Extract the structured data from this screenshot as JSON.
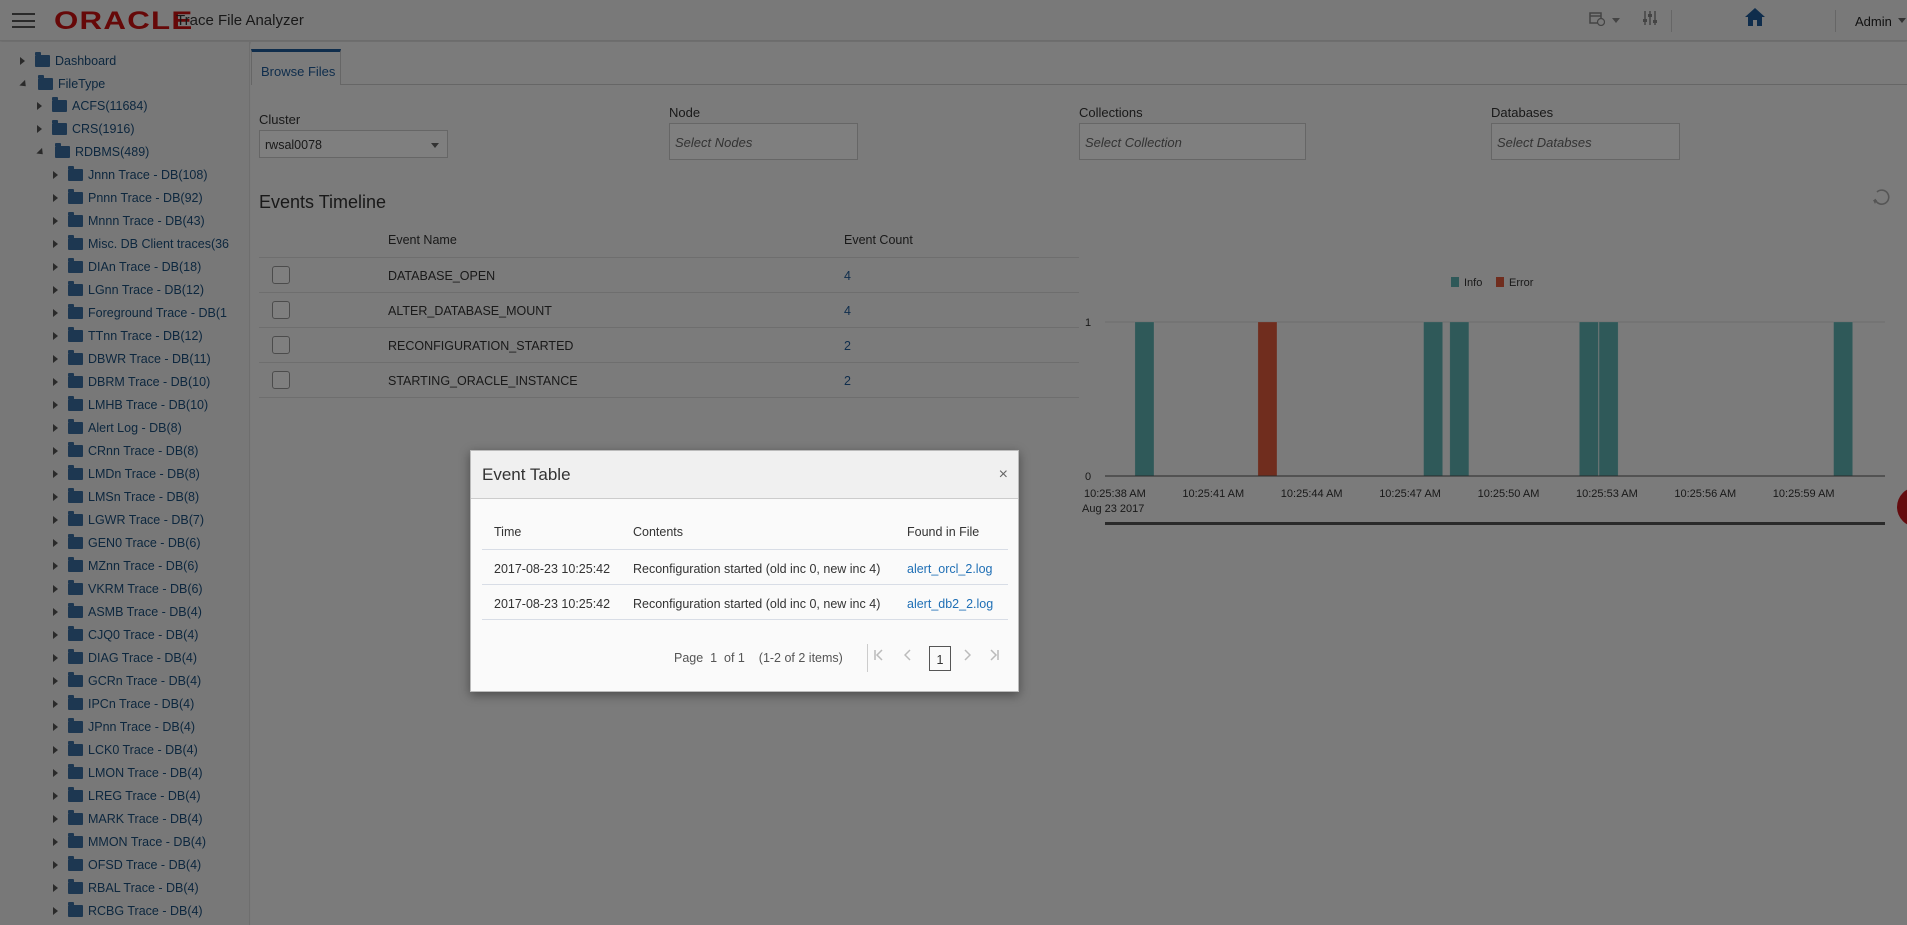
{
  "header": {
    "logo": "ORACLE",
    "app_title": "Trace File Analyzer",
    "user": "Admin",
    "icons": [
      "menu-icon",
      "calendar-clock-icon",
      "sliders-icon",
      "home-icon"
    ]
  },
  "sidebar": {
    "items": [
      {
        "label": "Dashboard",
        "level": 0,
        "expanded": false
      },
      {
        "label": "FileType",
        "level": 0,
        "expanded": true
      },
      {
        "label": "ACFS(11684)",
        "level": 1,
        "expanded": false
      },
      {
        "label": "CRS(1916)",
        "level": 1,
        "expanded": false
      },
      {
        "label": "RDBMS(489)",
        "level": 1,
        "expanded": true
      },
      {
        "label": "Jnnn Trace - DB(108)",
        "level": 2,
        "expanded": false
      },
      {
        "label": "Pnnn Trace - DB(92)",
        "level": 2,
        "expanded": false
      },
      {
        "label": "Mnnn Trace - DB(43)",
        "level": 2,
        "expanded": false
      },
      {
        "label": "Misc. DB Client traces(36",
        "level": 2,
        "expanded": false
      },
      {
        "label": "DIAn Trace - DB(18)",
        "level": 2,
        "expanded": false
      },
      {
        "label": "LGnn Trace - DB(12)",
        "level": 2,
        "expanded": false
      },
      {
        "label": "Foreground Trace - DB(1",
        "level": 2,
        "expanded": false
      },
      {
        "label": "TTnn Trace - DB(12)",
        "level": 2,
        "expanded": false
      },
      {
        "label": "DBWR Trace - DB(11)",
        "level": 2,
        "expanded": false
      },
      {
        "label": "DBRM Trace - DB(10)",
        "level": 2,
        "expanded": false
      },
      {
        "label": "LMHB Trace - DB(10)",
        "level": 2,
        "expanded": false
      },
      {
        "label": "Alert Log - DB(8)",
        "level": 2,
        "expanded": false
      },
      {
        "label": "CRnn Trace - DB(8)",
        "level": 2,
        "expanded": false
      },
      {
        "label": "LMDn Trace - DB(8)",
        "level": 2,
        "expanded": false
      },
      {
        "label": "LMSn Trace - DB(8)",
        "level": 2,
        "expanded": false
      },
      {
        "label": "LGWR Trace - DB(7)",
        "level": 2,
        "expanded": false
      },
      {
        "label": "GEN0 Trace - DB(6)",
        "level": 2,
        "expanded": false
      },
      {
        "label": "MZnn Trace - DB(6)",
        "level": 2,
        "expanded": false
      },
      {
        "label": "VKRM Trace - DB(6)",
        "level": 2,
        "expanded": false
      },
      {
        "label": "ASMB Trace - DB(4)",
        "level": 2,
        "expanded": false
      },
      {
        "label": "CJQ0 Trace - DB(4)",
        "level": 2,
        "expanded": false
      },
      {
        "label": "DIAG Trace - DB(4)",
        "level": 2,
        "expanded": false
      },
      {
        "label": "GCRn Trace - DB(4)",
        "level": 2,
        "expanded": false
      },
      {
        "label": "IPCn Trace - DB(4)",
        "level": 2,
        "expanded": false
      },
      {
        "label": "JPnn Trace - DB(4)",
        "level": 2,
        "expanded": false
      },
      {
        "label": "LCK0 Trace - DB(4)",
        "level": 2,
        "expanded": false
      },
      {
        "label": "LMON Trace - DB(4)",
        "level": 2,
        "expanded": false
      },
      {
        "label": "LREG Trace - DB(4)",
        "level": 2,
        "expanded": false
      },
      {
        "label": "MARK Trace - DB(4)",
        "level": 2,
        "expanded": false
      },
      {
        "label": "MMON Trace - DB(4)",
        "level": 2,
        "expanded": false
      },
      {
        "label": "OFSD Trace - DB(4)",
        "level": 2,
        "expanded": false
      },
      {
        "label": "RBAL Trace - DB(4)",
        "level": 2,
        "expanded": false
      },
      {
        "label": "RCBG Trace - DB(4)",
        "level": 2,
        "expanded": false
      }
    ]
  },
  "main": {
    "tab": "Browse Files",
    "filters": {
      "cluster": {
        "label": "Cluster",
        "value": "rwsal0078"
      },
      "node": {
        "label": "Node",
        "placeholder": "Select Nodes"
      },
      "collections": {
        "label": "Collections",
        "placeholder": "Select Collection"
      },
      "databases": {
        "label": "Databases",
        "placeholder": "Select Databses"
      }
    },
    "section_title": "Events Timeline",
    "events_table": {
      "headers": {
        "name": "Event Name",
        "count": "Event Count"
      },
      "rows": [
        {
          "name": "DATABASE_OPEN",
          "count": "4",
          "checked": false
        },
        {
          "name": "ALTER_DATABASE_MOUNT",
          "count": "4",
          "checked": false
        },
        {
          "name": "RECONFIGURATION_STARTED",
          "count": "2",
          "checked": false
        },
        {
          "name": "STARTING_ORACLE_INSTANCE",
          "count": "2",
          "checked": false
        }
      ]
    }
  },
  "chart_data": {
    "type": "bar",
    "title": "",
    "xlabel": "",
    "ylabel": "",
    "ylim": [
      0,
      1
    ],
    "y_ticks": [
      "0",
      "1"
    ],
    "x_range_seconds": [
      38,
      62
    ],
    "x_ticks": [
      {
        "t": 38,
        "label": "10:25:38 AM",
        "sublabel": "Aug 23 2017"
      },
      {
        "t": 41,
        "label": "10:25:41 AM"
      },
      {
        "t": 44,
        "label": "10:25:44 AM"
      },
      {
        "t": 47,
        "label": "10:25:47 AM"
      },
      {
        "t": 50,
        "label": "10:25:50 AM"
      },
      {
        "t": 53,
        "label": "10:25:53 AM"
      },
      {
        "t": 56,
        "label": "10:25:56 AM"
      },
      {
        "t": 59,
        "label": "10:25:59 AM"
      }
    ],
    "legend": {
      "position": "top-center",
      "entries": [
        {
          "name": "Info",
          "color": "#5fb3b3"
        },
        {
          "name": "Error",
          "color": "#e15b3c"
        }
      ]
    },
    "series": [
      {
        "name": "Info",
        "color": "#5fb3b3",
        "points": [
          {
            "t": 38.7,
            "value": 1
          },
          {
            "t": 47.5,
            "value": 1
          },
          {
            "t": 48.3,
            "value": 1
          },
          {
            "t": 52.25,
            "value": 1
          },
          {
            "t": 52.85,
            "value": 1
          },
          {
            "t": 60.0,
            "value": 1
          }
        ]
      },
      {
        "name": "Error",
        "color": "#e15b3c",
        "points": [
          {
            "t": 42.45,
            "value": 1
          }
        ]
      }
    ]
  },
  "modal": {
    "title": "Event Table",
    "close": "×",
    "headers": {
      "time": "Time",
      "contents": "Contents",
      "file": "Found in File"
    },
    "rows": [
      {
        "time": "2017-08-23 10:25:42",
        "contents": "Reconfiguration started (old inc 0, new inc 4)",
        "file": "alert_orcl_2.log"
      },
      {
        "time": "2017-08-23 10:25:42",
        "contents": "Reconfiguration started (old inc 0, new inc 4)",
        "file": "alert_db2_2.log"
      }
    ],
    "pager": {
      "text": "Page  1  of 1    (1-2 of 2 items)",
      "current_page": "1",
      "first": "K",
      "prev": "‹",
      "next": "›",
      "last": "K"
    }
  }
}
